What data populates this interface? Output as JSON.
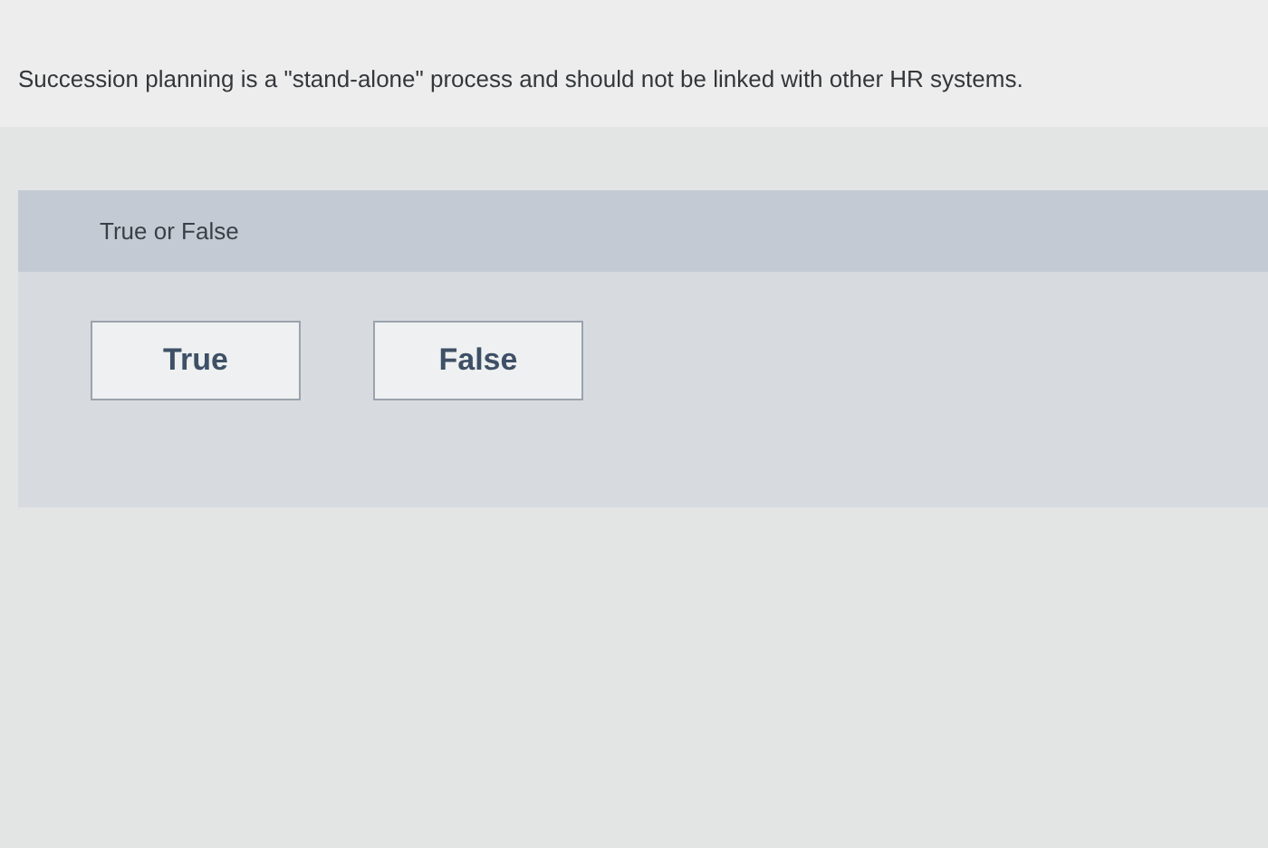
{
  "question": {
    "text": "Succession planning is a \"stand-alone\" process and should not be linked with other HR systems."
  },
  "panel": {
    "header": "True or False",
    "options": [
      {
        "label": "True"
      },
      {
        "label": "False"
      }
    ]
  }
}
